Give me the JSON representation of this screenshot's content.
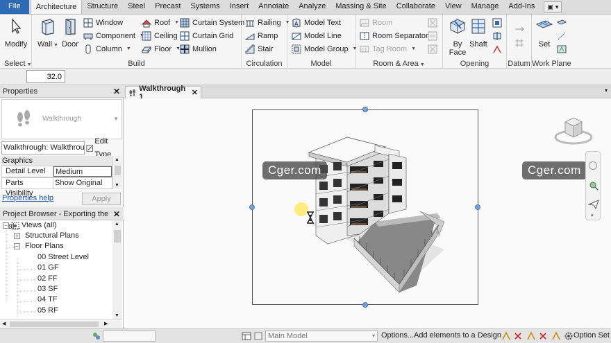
{
  "menu": {
    "tabs": [
      "File",
      "Architecture",
      "Structure",
      "Steel",
      "Precast",
      "Systems",
      "Insert",
      "Annotate",
      "Analyze",
      "Massing & Site",
      "Collaborate",
      "View",
      "Manage",
      "Add-Ins"
    ],
    "active": "Architecture"
  },
  "ribbon": {
    "select": {
      "modify": "Modify",
      "title": "Select"
    },
    "build": {
      "wall": "Wall",
      "door": "Door",
      "window": "Window",
      "component": "Component",
      "column": "Column",
      "roof": "Roof",
      "ceiling": "Ceiling",
      "floor": "Floor",
      "curtain_system": "Curtain System",
      "curtain_grid": "Curtain Grid",
      "mullion": "Mullion",
      "title": "Build"
    },
    "circulation": {
      "railing": "Railing",
      "ramp": "Ramp",
      "stair": "Stair",
      "title": "Circulation"
    },
    "model": {
      "model_text": "Model Text",
      "model_line": "Model Line",
      "model_group": "Model Group",
      "title": "Model"
    },
    "room_area": {
      "room": "Room",
      "room_separator": "Room Separator",
      "tag_room": "Tag Room",
      "title": "Room & Area"
    },
    "opening": {
      "by_face": "By Face",
      "shaft": "Shaft",
      "title": "Opening"
    },
    "datum": {
      "title": "Datum"
    },
    "work_plane": {
      "set": "Set",
      "title": "Work Plane"
    }
  },
  "options_bar": {
    "offset_value": "32.0"
  },
  "properties": {
    "title": "Properties",
    "type_name": "Walkthrough",
    "instance": "Walkthrough: Walkthrou",
    "edit_type": "Edit Type",
    "group": "Graphics",
    "rows": [
      {
        "key": "Detail Level",
        "value": "Medium"
      },
      {
        "key": "Parts Visibility",
        "value": "Show Original"
      }
    ],
    "help_link": "Properties help",
    "apply": "Apply"
  },
  "project_browser": {
    "title": "Project Browser - Exporting the wal...",
    "root": "Views (all)",
    "structural_plans": "Structural Plans",
    "floor_plans": "Floor Plans",
    "plans": [
      "00 Street Level",
      "01 GF",
      "02 FF",
      "03 SF",
      "04 TF",
      "05 RF"
    ]
  },
  "view": {
    "tab": "Walkthrough 1",
    "watermark_left": "Cger.com",
    "watermark_right": "Cger.com"
  },
  "status": {
    "model": "Main Model",
    "options": "Options...",
    "message": "Add elements to a Design O",
    "option_set": "Option Set"
  },
  "colors": {
    "file_tab": "#2f6ab4",
    "grip": "#7a9fd6",
    "link": "#1a4fa8"
  }
}
